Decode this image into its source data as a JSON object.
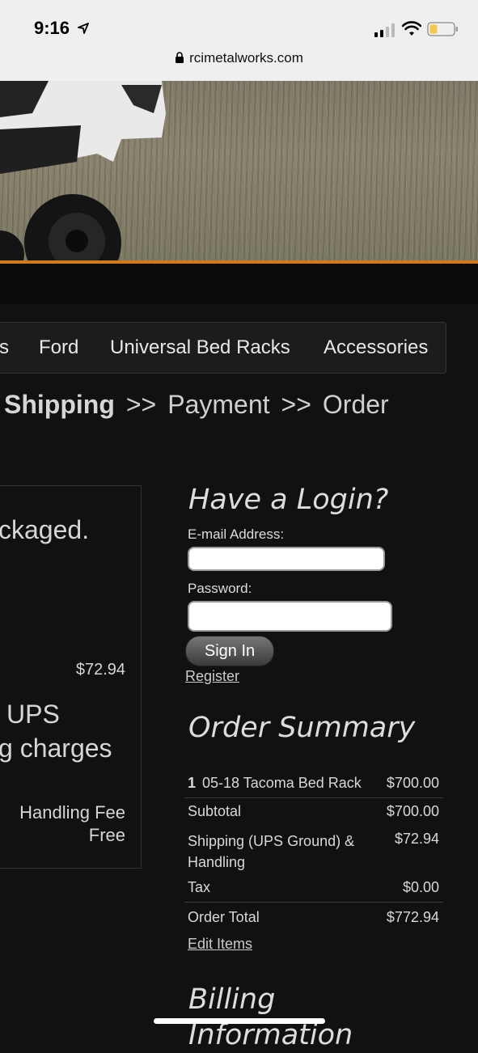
{
  "status_bar": {
    "time": "9:16"
  },
  "url_bar": {
    "domain": "rcimetalworks.com"
  },
  "nav": {
    "items": [
      "s",
      "Ford",
      "Universal Bed Racks",
      "Accessories"
    ]
  },
  "steps": {
    "current": "Shipping",
    "sep1": ">>",
    "payment": "Payment",
    "sep2": ">>",
    "order": "Order"
  },
  "shipping_box": {
    "packaged_text": "ckaged.",
    "price": "$72.94",
    "ups_text": "UPS",
    "charges_text": "g charges",
    "handling_label": "Handling Fee",
    "handling_value": "Free"
  },
  "login": {
    "title": "Have a Login?",
    "email_label": "E-mail Address:",
    "email_value": "",
    "password_label": "Password:",
    "password_value": "",
    "signin_label": "Sign In",
    "register_label": "Register"
  },
  "order_summary": {
    "title": "Order Summary",
    "item_qty": "1",
    "item_name": "05-18 Tacoma Bed Rack",
    "item_price": "$700.00",
    "subtotal_label": "Subtotal",
    "subtotal_value": "$700.00",
    "shipping_label_1": "Shipping (UPS Ground)  &",
    "shipping_label_2": "Handling",
    "shipping_value": "$72.94",
    "tax_label": "Tax",
    "tax_value": "$0.00",
    "total_label": "Order Total",
    "total_value": "$772.94",
    "edit_items_label": "Edit Items"
  },
  "billing": {
    "title_1": "Billing",
    "title_2": "Information"
  },
  "colors": {
    "background": "#111111",
    "accent_stripe": "#d07a1c",
    "statusbar": "#efefef"
  }
}
